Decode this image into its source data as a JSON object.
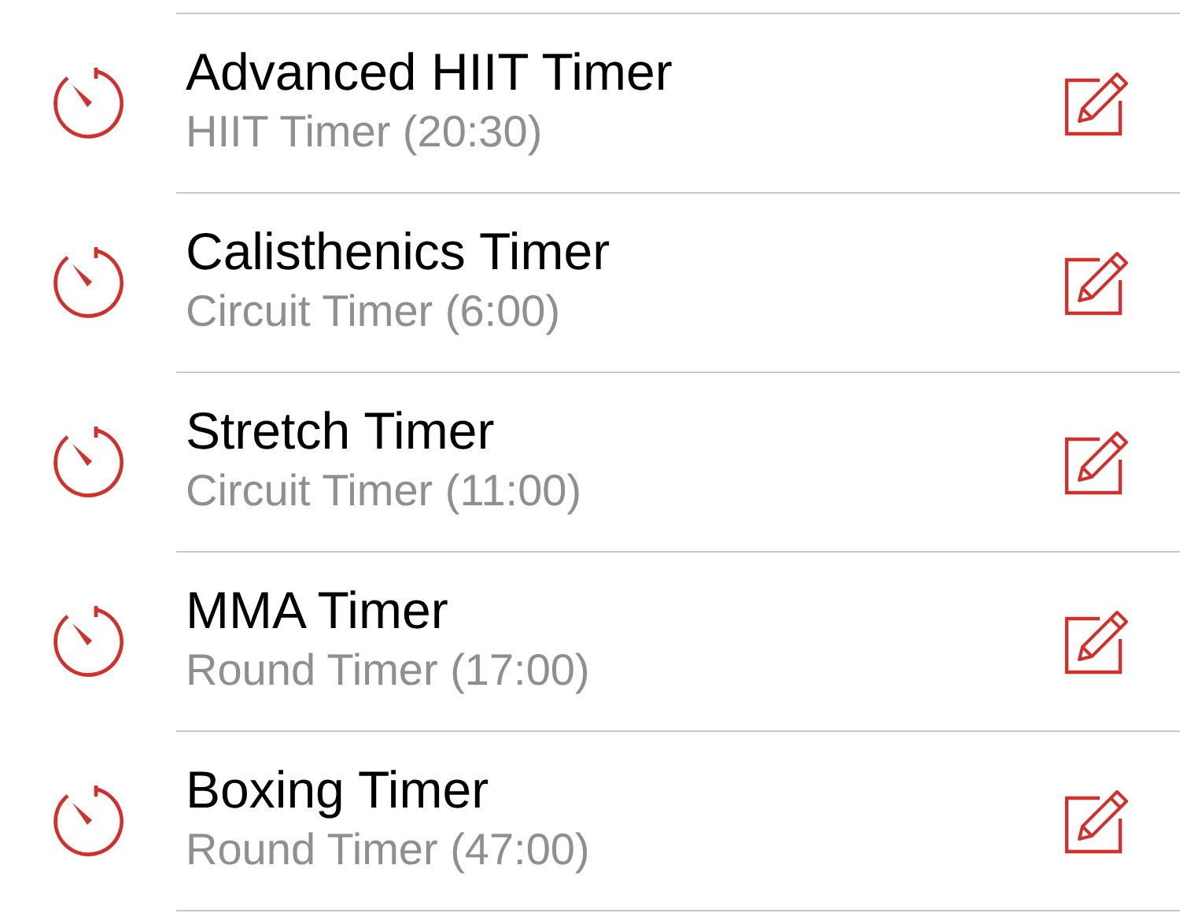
{
  "timers": [
    {
      "name": "Advanced HIIT Timer",
      "detail": "HIIT Timer (20:30)"
    },
    {
      "name": "Calisthenics Timer",
      "detail": "Circuit Timer (6:00)"
    },
    {
      "name": "Stretch Timer",
      "detail": "Circuit Timer (11:00)"
    },
    {
      "name": "MMA Timer",
      "detail": "Round Timer (17:00)"
    },
    {
      "name": "Boxing Timer",
      "detail": "Round Timer (47:00)"
    }
  ]
}
